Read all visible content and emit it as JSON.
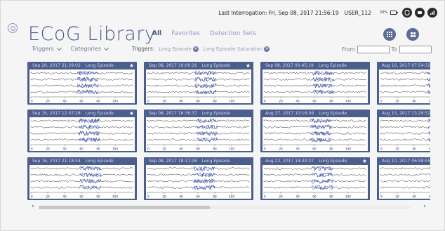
{
  "status_bar": {
    "last_interrogation": "Last Interrogation: Fri, Sep 08, 2017  21:56:19",
    "user": "USER_112",
    "battery": "20%",
    "icons": [
      "battery-icon",
      "sync-icon",
      "device-icon",
      "signal-icon"
    ]
  },
  "header": {
    "title": "ECoG Library",
    "tabs": [
      {
        "label": "All",
        "active": true
      },
      {
        "label": "Favorites",
        "active": false
      },
      {
        "label": "Detection Sets",
        "active": false
      }
    ]
  },
  "filters": {
    "triggers_dropdown": "Triggers",
    "categories_dropdown": "Categories",
    "active_label": "Triggers:",
    "chips": [
      "Long Episode",
      "Long Episode Saturation"
    ],
    "from_label": "From",
    "to_label": "To",
    "from_value": "",
    "to_value": ""
  },
  "axis_ticks": [
    "0",
    "20",
    "40",
    "60",
    "80",
    "100"
  ],
  "cards": [
    {
      "timestamp": "Sep 20, 2017 21:29:02",
      "category": "Long Episode",
      "favorite": true
    },
    {
      "timestamp": "Sep 08, 2017 19:00:16",
      "category": "Long Episode",
      "favorite": true
    },
    {
      "timestamp": "Sep 08, 2017 00:45:19",
      "category": "Long Episode",
      "favorite": false
    },
    {
      "timestamp": "Aug 16, 2017 07:54:32",
      "category": "",
      "favorite": false
    },
    {
      "timestamp": "Sep 19, 2017 12:07:28",
      "category": "Long Episode",
      "favorite": true
    },
    {
      "timestamp": "Sep 08, 2017 18:36:37",
      "category": "Long Episode",
      "favorite": false
    },
    {
      "timestamp": "Aug 27, 2017 10:16:06",
      "category": "Long Episode",
      "favorite": false
    },
    {
      "timestamp": "Aug 15, 2017 13:29:52",
      "category": "",
      "favorite": false
    },
    {
      "timestamp": "Sep 16, 2017 21:18:54",
      "category": "Long Episode",
      "favorite": false
    },
    {
      "timestamp": "Sep 08, 2017 18:11:26",
      "category": "Long Episode",
      "favorite": false
    },
    {
      "timestamp": "Aug 22, 2017 14:30:27",
      "category": "Long Episode",
      "favorite": true
    },
    {
      "timestamp": "Aug 10, 2017 06:58:55",
      "category": "",
      "favorite": false
    }
  ],
  "scrollbar": {
    "position_fraction": 0.0,
    "visible_fraction": 0.46
  },
  "colors": {
    "card_bg": "#4b5e8c",
    "accent": "#4a5a8a",
    "trace": "#111111",
    "highlight": "#3a55c8"
  }
}
